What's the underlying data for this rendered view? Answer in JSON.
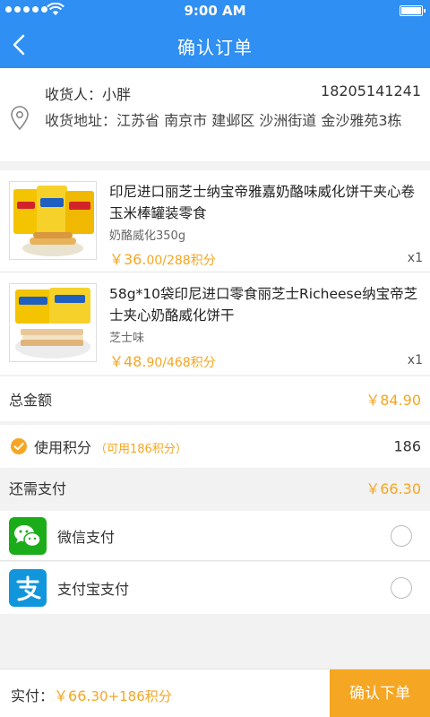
{
  "status_bar": {
    "time": "9:00 AM"
  },
  "header": {
    "title": "确认订单"
  },
  "address": {
    "receiver_label": "收货人：",
    "receiver_name": "小胖",
    "phone": "18205141241",
    "address_label": "收货地址：",
    "address_value": "江苏省 南京市 建邺区 沙洲街道 金沙雅苑3栋"
  },
  "items": [
    {
      "name": "印尼进口丽芝士纳宝帝雅嘉奶酪味威化饼干夹心卷玉米棒罐装零食",
      "spec": "奶酪威化350g",
      "price_main": "￥36.",
      "price_cents": "00/288积分",
      "qty": "x1"
    },
    {
      "name": "58g*10袋印尼进口零食丽芝士Richeese纳宝帝芝士夹心奶酪威化饼干",
      "spec": "芝士味",
      "price_main": "￥48.",
      "price_cents": "90/468积分",
      "qty": "x1"
    }
  ],
  "summary": {
    "total_label": "总金额",
    "total_value": "￥84.90",
    "points_label": "使用积分",
    "points_available": "（可用186积分）",
    "points_value": "186",
    "due_label": "还需支付",
    "due_value": "￥66.30"
  },
  "payment": {
    "wechat_label": "微信支付",
    "alipay_label": "支付宝支付"
  },
  "footer": {
    "paid_label": "实付：",
    "paid_main": "￥66.",
    "paid_rest": "30+186积分",
    "confirm_label": "确认下单"
  },
  "colors": {
    "primary": "#2f8ff2",
    "accent": "#f5a623",
    "wechat": "#1aad19",
    "alipay": "#1296db"
  }
}
